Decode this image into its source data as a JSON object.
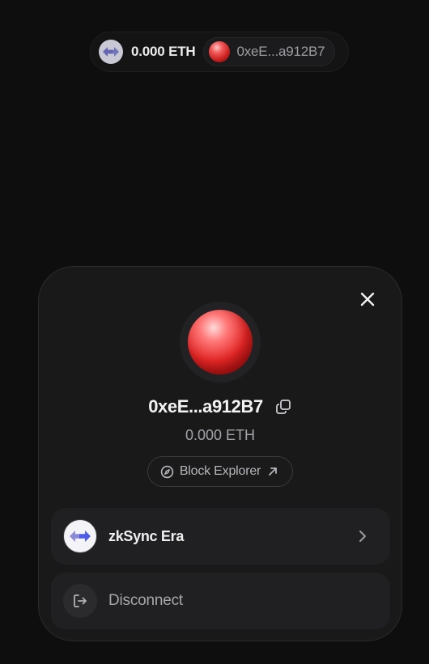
{
  "account_button": {
    "balance": "0.000 ETH",
    "address_short": "0xeE...a912B7",
    "network_icon": "zksync-arrows-icon"
  },
  "modal": {
    "address": "0xeE...a912B7",
    "balance": "0.000 ETH",
    "explorer_label": "Block Explorer",
    "network": {
      "name": "zkSync Era",
      "icon": "zksync-logo-icon"
    },
    "disconnect_label": "Disconnect"
  },
  "colors": {
    "background": "#0e0e0f",
    "modal_background": "#19191a",
    "card_background": "#202022",
    "avatar_red": "#e32626",
    "zksync_purple": "#6e6ec8",
    "zksync_blue": "#4e5ae8"
  }
}
